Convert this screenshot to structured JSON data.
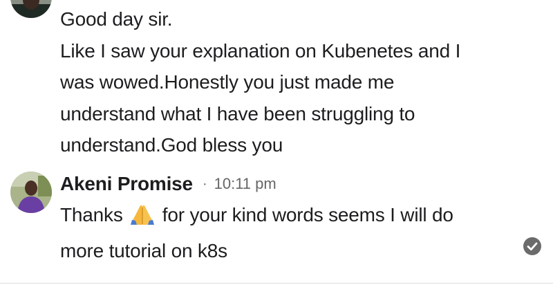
{
  "conversation": {
    "previous_message": {
      "text": "Good day sir.\nLike I saw your explanation on Kubenetes and I\nwas wowed.Honestly you just made me\nunderstand what I have been struggling to\nunderstand.God bless you"
    },
    "reply": {
      "sender_name": "Akeni Promise",
      "separator": "·",
      "timestamp": "10:11 pm",
      "text_part1": "Thanks ",
      "emoji": "🙏",
      "emoji_icon": "folded-hands-icon",
      "text_part2": " for your kind words seems I will do",
      "text_line2": "more tutorial on k8s",
      "status_icon": "check-circle-icon"
    }
  },
  "colors": {
    "text": "#1d1d1f",
    "muted": "#666666",
    "receipt": "#6b6b6b",
    "divider": "#dcdcdc"
  }
}
